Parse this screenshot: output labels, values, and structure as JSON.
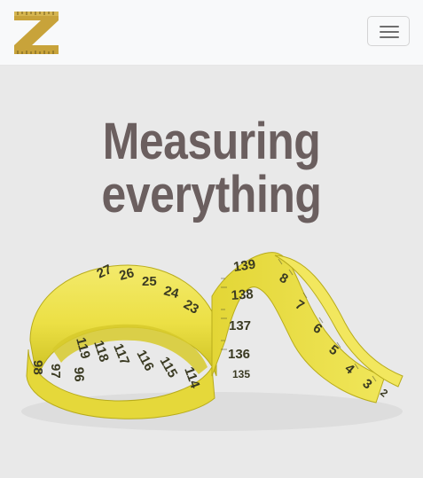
{
  "navbar": {
    "logo_icon": "ruler-z-logo",
    "toggle_icon": "hamburger-menu-icon"
  },
  "hero": {
    "title_line1": "Measuring",
    "title_line2": "everything",
    "image_icon": "measuring-tape-image"
  },
  "tape": {
    "numbers": [
      "139",
      "138",
      "137",
      "136",
      "135",
      "8",
      "7",
      "6",
      "5",
      "4",
      "3",
      "2",
      "27",
      "26",
      "25",
      "24",
      "23",
      "119",
      "118",
      "117",
      "116",
      "115",
      "114",
      "98",
      "97",
      "96"
    ]
  },
  "colors": {
    "tape_yellow": "#ece045",
    "logo_gold": "#c8a33a",
    "title_text": "#6b5f5f"
  }
}
